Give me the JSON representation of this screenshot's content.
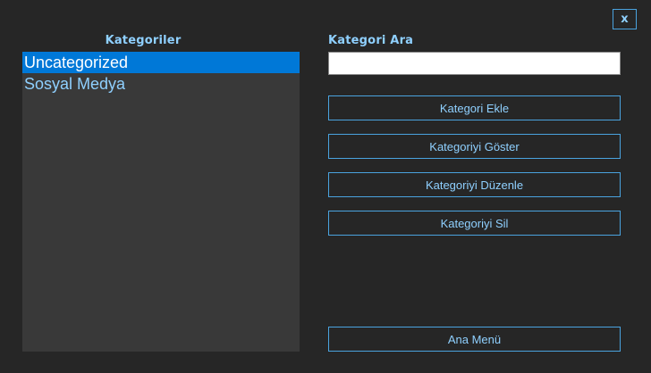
{
  "window": {
    "close_label": "x"
  },
  "categories_panel": {
    "title": "Kategoriler",
    "items": [
      {
        "label": "Uncategorized",
        "selected": true
      },
      {
        "label": "Sosyal Medya",
        "selected": false
      }
    ]
  },
  "search": {
    "title": "Kategori Ara",
    "value": "",
    "placeholder": ""
  },
  "actions": {
    "add_label": "Kategori Ekle",
    "show_label": "Kategoriyi Göster",
    "edit_label": "Kategoriyi Düzenle",
    "delete_label": "Kategoriyi Sil",
    "main_menu_label": "Ana Menü"
  },
  "colors": {
    "background": "#262626",
    "list_background": "#393939",
    "accent_text": "#8fd0ff",
    "button_border": "#4aa3df",
    "selection": "#0078d7"
  }
}
